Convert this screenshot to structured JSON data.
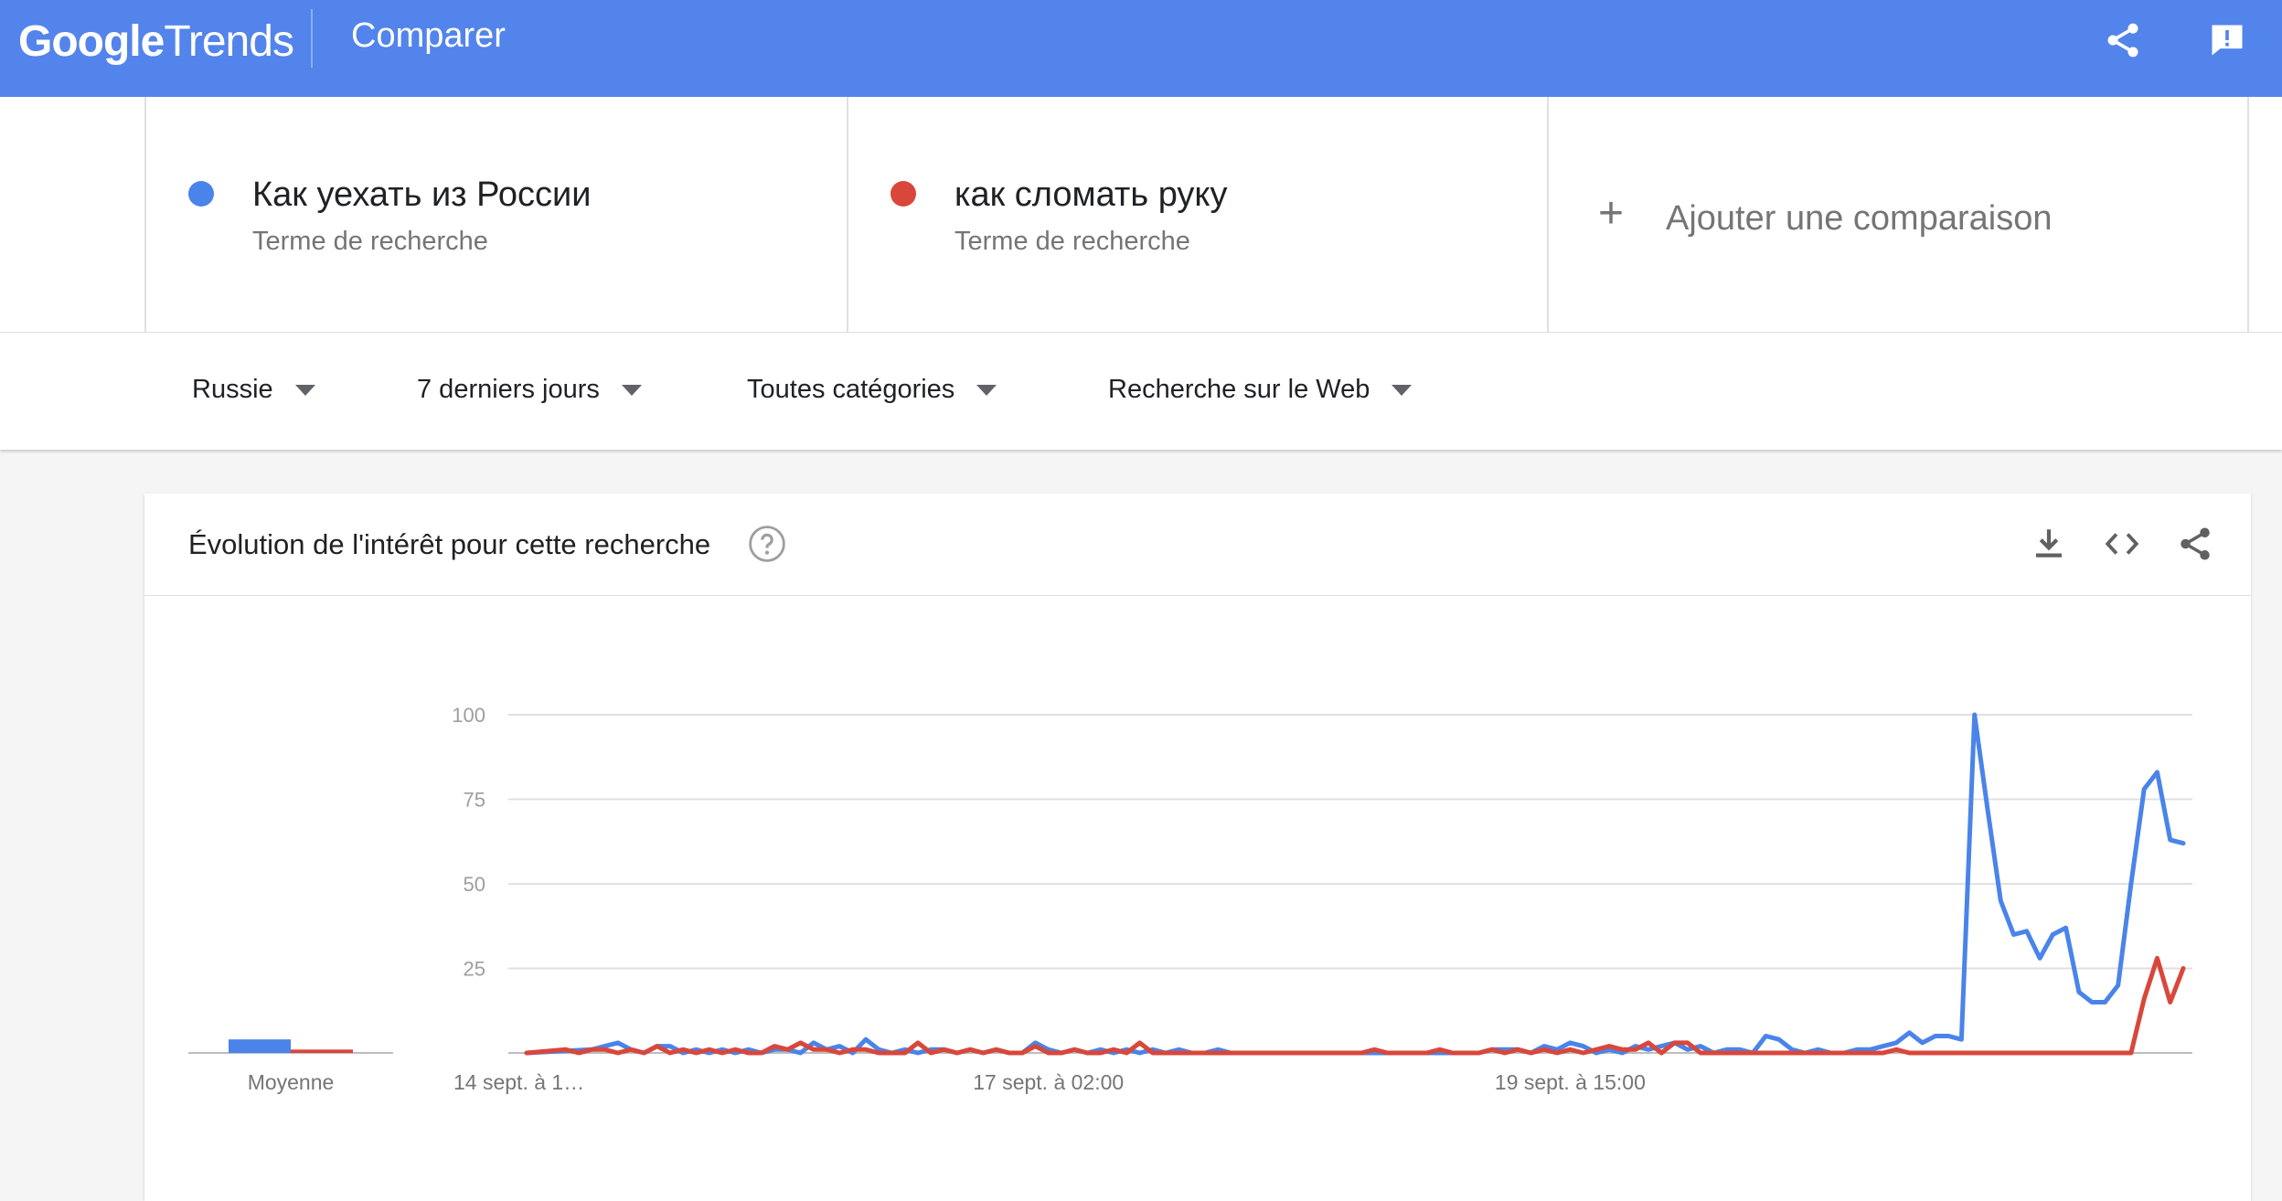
{
  "header": {
    "logo_google": "Google",
    "logo_trends": "Trends",
    "title": "Comparer"
  },
  "terms": [
    {
      "name": "Как уехать из России",
      "subtitle": "Terme de recherche",
      "color": "#4a84ea"
    },
    {
      "name": "как сломать руку",
      "subtitle": "Terme de recherche",
      "color": "#d9473b"
    }
  ],
  "add_comparison": {
    "label": "Ajouter une comparaison"
  },
  "filters": [
    {
      "label": "Russie"
    },
    {
      "label": "7 derniers jours"
    },
    {
      "label": "Toutes catégories"
    },
    {
      "label": "Recherche sur le Web"
    }
  ],
  "panel": {
    "title": "Évolution de l'intérêt pour cette recherche"
  },
  "chart_data": {
    "type": "line",
    "yticks": [
      100,
      75,
      50,
      25
    ],
    "ylim": [
      0,
      100
    ],
    "xtick_labels": [
      "14 sept. à 1…",
      "17 sept. à 02:00",
      "19 sept. à 15:00"
    ],
    "xtick_positions": [
      0,
      80,
      160
    ],
    "average_label": "Moyenne",
    "average_values": [
      4,
      1
    ],
    "n_points": 220,
    "series": [
      {
        "color": "#4a84ea",
        "points": [
          [
            0,
            0
          ],
          [
            10,
            1
          ],
          [
            12,
            2
          ],
          [
            14,
            3
          ],
          [
            16,
            1
          ],
          [
            18,
            0
          ],
          [
            20,
            2
          ],
          [
            22,
            2
          ],
          [
            24,
            0
          ],
          [
            26,
            1
          ],
          [
            28,
            0
          ],
          [
            30,
            1
          ],
          [
            32,
            0
          ],
          [
            34,
            1
          ],
          [
            36,
            0
          ],
          [
            38,
            1
          ],
          [
            40,
            1
          ],
          [
            42,
            0
          ],
          [
            44,
            3
          ],
          [
            46,
            1
          ],
          [
            48,
            2
          ],
          [
            50,
            0
          ],
          [
            52,
            4
          ],
          [
            54,
            1
          ],
          [
            56,
            0
          ],
          [
            58,
            1
          ],
          [
            60,
            0
          ],
          [
            62,
            1
          ],
          [
            64,
            1
          ],
          [
            66,
            0
          ],
          [
            68,
            1
          ],
          [
            70,
            0
          ],
          [
            72,
            1
          ],
          [
            74,
            0
          ],
          [
            76,
            0
          ],
          [
            78,
            3
          ],
          [
            80,
            1
          ],
          [
            82,
            0
          ],
          [
            84,
            1
          ],
          [
            86,
            0
          ],
          [
            88,
            1
          ],
          [
            90,
            0
          ],
          [
            92,
            1
          ],
          [
            94,
            0
          ],
          [
            96,
            1
          ],
          [
            98,
            0
          ],
          [
            100,
            1
          ],
          [
            102,
            0
          ],
          [
            104,
            0
          ],
          [
            106,
            1
          ],
          [
            108,
            0
          ],
          [
            110,
            0
          ],
          [
            112,
            0
          ],
          [
            114,
            0
          ],
          [
            116,
            0
          ],
          [
            118,
            0
          ],
          [
            120,
            0
          ],
          [
            122,
            0
          ],
          [
            124,
            0
          ],
          [
            126,
            0
          ],
          [
            128,
            0
          ],
          [
            130,
            0
          ],
          [
            132,
            0
          ],
          [
            134,
            0
          ],
          [
            136,
            0
          ],
          [
            138,
            0
          ],
          [
            140,
            0
          ],
          [
            142,
            0
          ],
          [
            144,
            0
          ],
          [
            146,
            0
          ],
          [
            148,
            1
          ],
          [
            150,
            1
          ],
          [
            152,
            1
          ],
          [
            154,
            0
          ],
          [
            156,
            2
          ],
          [
            158,
            1
          ],
          [
            160,
            3
          ],
          [
            162,
            2
          ],
          [
            164,
            0
          ],
          [
            166,
            1
          ],
          [
            168,
            0
          ],
          [
            170,
            2
          ],
          [
            172,
            1
          ],
          [
            174,
            2
          ],
          [
            176,
            3
          ],
          [
            178,
            1
          ],
          [
            180,
            2
          ],
          [
            182,
            0
          ],
          [
            184,
            1
          ],
          [
            186,
            1
          ],
          [
            188,
            0
          ],
          [
            190,
            5
          ],
          [
            192,
            4
          ],
          [
            194,
            1
          ],
          [
            196,
            0
          ],
          [
            198,
            1
          ],
          [
            200,
            0
          ],
          [
            202,
            0
          ],
          [
            204,
            1
          ],
          [
            206,
            1
          ],
          [
            208,
            2
          ],
          [
            210,
            3
          ],
          [
            212,
            6
          ],
          [
            214,
            3
          ],
          [
            216,
            5
          ],
          [
            218,
            5
          ],
          [
            220,
            4
          ],
          [
            222,
            100
          ],
          [
            224,
            72
          ],
          [
            226,
            45
          ],
          [
            228,
            35
          ],
          [
            230,
            36
          ],
          [
            232,
            28
          ],
          [
            234,
            35
          ],
          [
            236,
            37
          ],
          [
            238,
            18
          ],
          [
            240,
            15
          ],
          [
            242,
            15
          ],
          [
            244,
            20
          ],
          [
            246,
            50
          ],
          [
            248,
            78
          ],
          [
            250,
            83
          ],
          [
            252,
            63
          ],
          [
            254,
            62
          ]
        ]
      },
      {
        "color": "#d9473b",
        "points": [
          [
            0,
            0
          ],
          [
            6,
            1
          ],
          [
            8,
            0
          ],
          [
            10,
            1
          ],
          [
            12,
            1
          ],
          [
            14,
            0
          ],
          [
            16,
            1
          ],
          [
            18,
            0
          ],
          [
            20,
            2
          ],
          [
            22,
            0
          ],
          [
            24,
            1
          ],
          [
            26,
            0
          ],
          [
            28,
            1
          ],
          [
            30,
            0
          ],
          [
            32,
            1
          ],
          [
            34,
            0
          ],
          [
            36,
            0
          ],
          [
            38,
            2
          ],
          [
            40,
            1
          ],
          [
            42,
            3
          ],
          [
            44,
            1
          ],
          [
            46,
            1
          ],
          [
            48,
            0
          ],
          [
            50,
            1
          ],
          [
            52,
            1
          ],
          [
            54,
            0
          ],
          [
            56,
            0
          ],
          [
            58,
            0
          ],
          [
            60,
            3
          ],
          [
            62,
            0
          ],
          [
            64,
            1
          ],
          [
            66,
            0
          ],
          [
            68,
            1
          ],
          [
            70,
            0
          ],
          [
            72,
            1
          ],
          [
            74,
            0
          ],
          [
            76,
            0
          ],
          [
            78,
            2
          ],
          [
            80,
            0
          ],
          [
            82,
            0
          ],
          [
            84,
            1
          ],
          [
            86,
            0
          ],
          [
            88,
            0
          ],
          [
            90,
            1
          ],
          [
            92,
            0
          ],
          [
            94,
            3
          ],
          [
            96,
            0
          ],
          [
            98,
            0
          ],
          [
            100,
            0
          ],
          [
            102,
            0
          ],
          [
            104,
            0
          ],
          [
            106,
            0
          ],
          [
            108,
            0
          ],
          [
            110,
            0
          ],
          [
            112,
            0
          ],
          [
            114,
            0
          ],
          [
            116,
            0
          ],
          [
            118,
            0
          ],
          [
            120,
            0
          ],
          [
            122,
            0
          ],
          [
            124,
            0
          ],
          [
            126,
            0
          ],
          [
            128,
            0
          ],
          [
            130,
            1
          ],
          [
            132,
            0
          ],
          [
            134,
            0
          ],
          [
            136,
            0
          ],
          [
            138,
            0
          ],
          [
            140,
            1
          ],
          [
            142,
            0
          ],
          [
            144,
            0
          ],
          [
            146,
            0
          ],
          [
            148,
            1
          ],
          [
            150,
            0
          ],
          [
            152,
            1
          ],
          [
            154,
            0
          ],
          [
            156,
            1
          ],
          [
            158,
            0
          ],
          [
            160,
            1
          ],
          [
            162,
            0
          ],
          [
            164,
            1
          ],
          [
            166,
            2
          ],
          [
            168,
            1
          ],
          [
            170,
            1
          ],
          [
            172,
            3
          ],
          [
            174,
            0
          ],
          [
            176,
            3
          ],
          [
            178,
            3
          ],
          [
            180,
            0
          ],
          [
            182,
            0
          ],
          [
            184,
            0
          ],
          [
            186,
            0
          ],
          [
            188,
            0
          ],
          [
            190,
            0
          ],
          [
            192,
            0
          ],
          [
            194,
            0
          ],
          [
            196,
            0
          ],
          [
            198,
            0
          ],
          [
            200,
            0
          ],
          [
            202,
            0
          ],
          [
            204,
            0
          ],
          [
            206,
            0
          ],
          [
            208,
            0
          ],
          [
            210,
            1
          ],
          [
            212,
            0
          ],
          [
            214,
            0
          ],
          [
            216,
            0
          ],
          [
            218,
            0
          ],
          [
            220,
            0
          ],
          [
            222,
            0
          ],
          [
            224,
            0
          ],
          [
            226,
            0
          ],
          [
            228,
            0
          ],
          [
            230,
            0
          ],
          [
            232,
            0
          ],
          [
            234,
            0
          ],
          [
            236,
            0
          ],
          [
            238,
            0
          ],
          [
            240,
            0
          ],
          [
            242,
            0
          ],
          [
            244,
            0
          ],
          [
            246,
            0
          ],
          [
            248,
            16
          ],
          [
            250,
            28
          ],
          [
            252,
            15
          ],
          [
            254,
            25
          ]
        ]
      }
    ]
  }
}
